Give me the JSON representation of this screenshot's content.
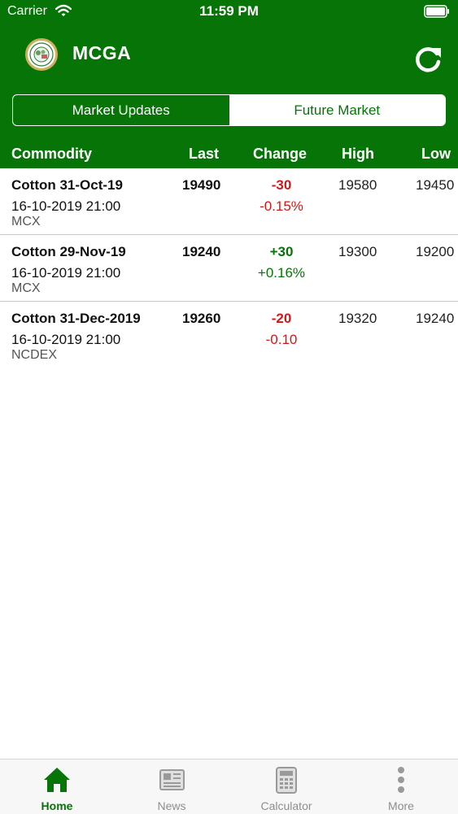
{
  "status_bar": {
    "carrier": "Carrier",
    "time": "11:59 PM"
  },
  "header": {
    "title": "MCGA",
    "refresh_icon": "refresh-icon",
    "logo": "association-seal-logo"
  },
  "segments": [
    {
      "label": "Market Updates",
      "selected": false
    },
    {
      "label": "Future Market",
      "selected": true
    }
  ],
  "columns": {
    "commodity": "Commodity",
    "last": "Last",
    "change": "Change",
    "high": "High",
    "low": "Low"
  },
  "rows": [
    {
      "name": "Cotton 31-Oct-19",
      "date": "16-10-2019 21:00",
      "exchange": "MCX",
      "last": "19490",
      "change": "-30",
      "change_pct": "-0.15%",
      "high": "19580",
      "low": "19450",
      "direction": "down"
    },
    {
      "name": "Cotton 29-Nov-19",
      "date": "16-10-2019 21:00",
      "exchange": "MCX",
      "last": "19240",
      "change": "+30",
      "change_pct": "+0.16%",
      "high": "19300",
      "low": "19200",
      "direction": "up"
    },
    {
      "name": "Cotton 31-Dec-2019",
      "date": "16-10-2019 21:00",
      "exchange": "NCDEX",
      "last": "19260",
      "change": "-20",
      "change_pct": "-0.10",
      "high": "19320",
      "low": "19240",
      "direction": "down"
    }
  ],
  "tabs": [
    {
      "label": "Home",
      "icon": "home-icon",
      "active": true
    },
    {
      "label": "News",
      "icon": "newspaper-icon",
      "active": false
    },
    {
      "label": "Calculator",
      "icon": "calculator-icon",
      "active": false
    },
    {
      "label": "More",
      "icon": "more-vertical-icon",
      "active": false
    }
  ],
  "colors": {
    "primary": "#067407",
    "negative": "#d01818",
    "positive": "#067407",
    "logo_ring": "#cdb05a"
  }
}
